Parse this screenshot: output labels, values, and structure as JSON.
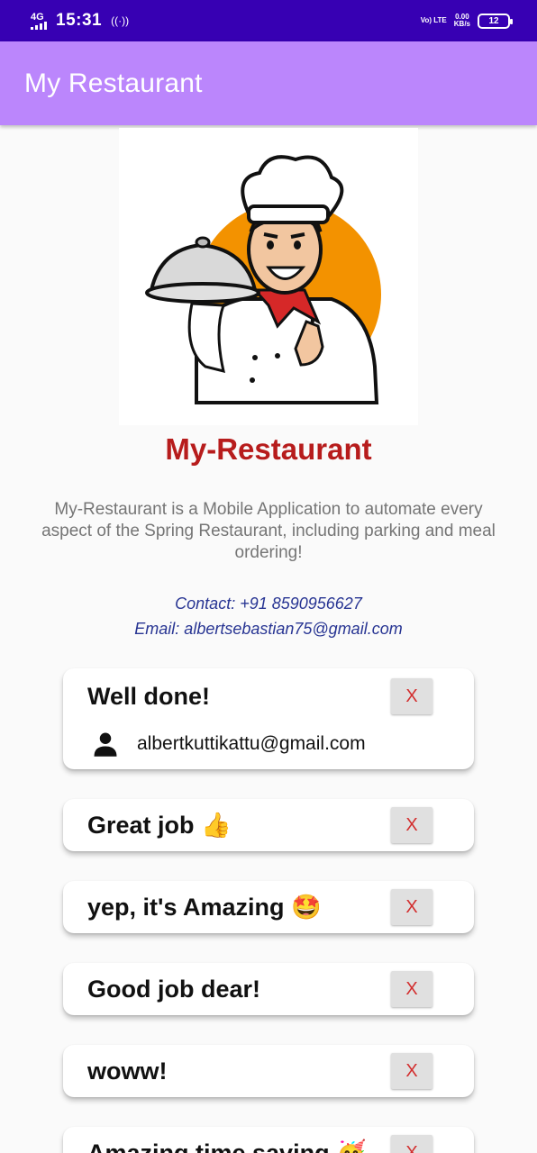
{
  "status_bar": {
    "network": "4G",
    "time": "15:31",
    "volte": "Vo) LTE",
    "speed_value": "0.00",
    "speed_unit": "KB/s",
    "battery": "12"
  },
  "app_bar": {
    "title": "My Restaurant"
  },
  "hero": {
    "image": "chef-mascot-illustration"
  },
  "brand": "My-Restaurant",
  "description": "My-Restaurant is a Mobile Application to automate every aspect of the Spring Restaurant, including parking and meal ordering!",
  "contact": {
    "phone": "Contact: +91 8590956627",
    "email": "Email: albertsebastian75@gmail.com"
  },
  "reviews": [
    {
      "text": "Well done!",
      "user": "albertkuttikattu@gmail.com",
      "delete": "X"
    },
    {
      "text": "Great job 👍",
      "delete": "X"
    },
    {
      "text": "yep, it's Amazing 🤩",
      "delete": "X"
    },
    {
      "text": "Good job dear!",
      "delete": "X"
    },
    {
      "text": "woww!",
      "delete": "X"
    },
    {
      "text": "Amazing time saving 🥳",
      "delete": "X"
    }
  ],
  "icons": {
    "user": "person-icon",
    "hotspot": "hotspot-icon"
  }
}
